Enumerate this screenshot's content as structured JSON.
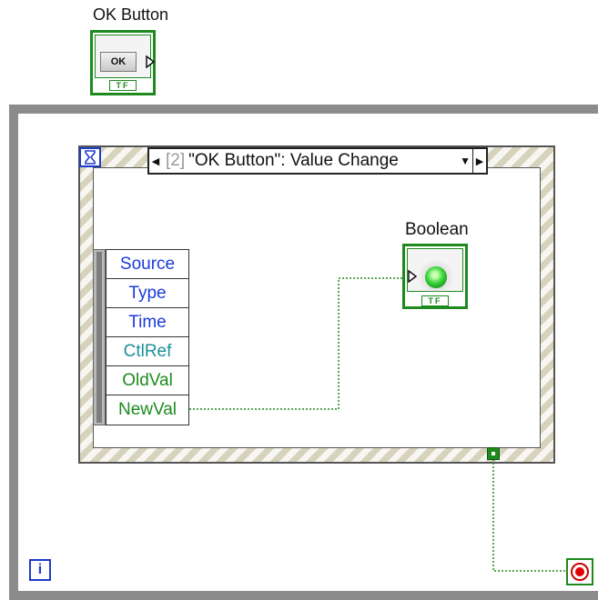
{
  "ok_button": {
    "label": "OK Button",
    "button_text": "OK",
    "type_tag": "TF"
  },
  "event_structure": {
    "case_index": "[2]",
    "case_name": "\"OK Button\": Value Change",
    "timeout_icon": "hourglass-icon",
    "event_data": [
      {
        "label": "Source",
        "color": "#1a3cd8"
      },
      {
        "label": "Type",
        "color": "#1a3cd8"
      },
      {
        "label": "Time",
        "color": "#1a3cd8"
      },
      {
        "label": "CtlRef",
        "color": "#1c8f9a"
      },
      {
        "label": "OldVal",
        "color": "#1e8a1e"
      },
      {
        "label": "NewVal",
        "color": "#1e8a1e"
      }
    ]
  },
  "boolean_indicator": {
    "label": "Boolean",
    "type_tag": "TF"
  },
  "while_loop": {
    "iteration_label": "i",
    "stop_icon": "stop-icon"
  },
  "colors": {
    "boolean_wire": "#1e8a1e",
    "loop_border": "#8c8c8c",
    "iteration_blue": "#1e3cc8"
  }
}
